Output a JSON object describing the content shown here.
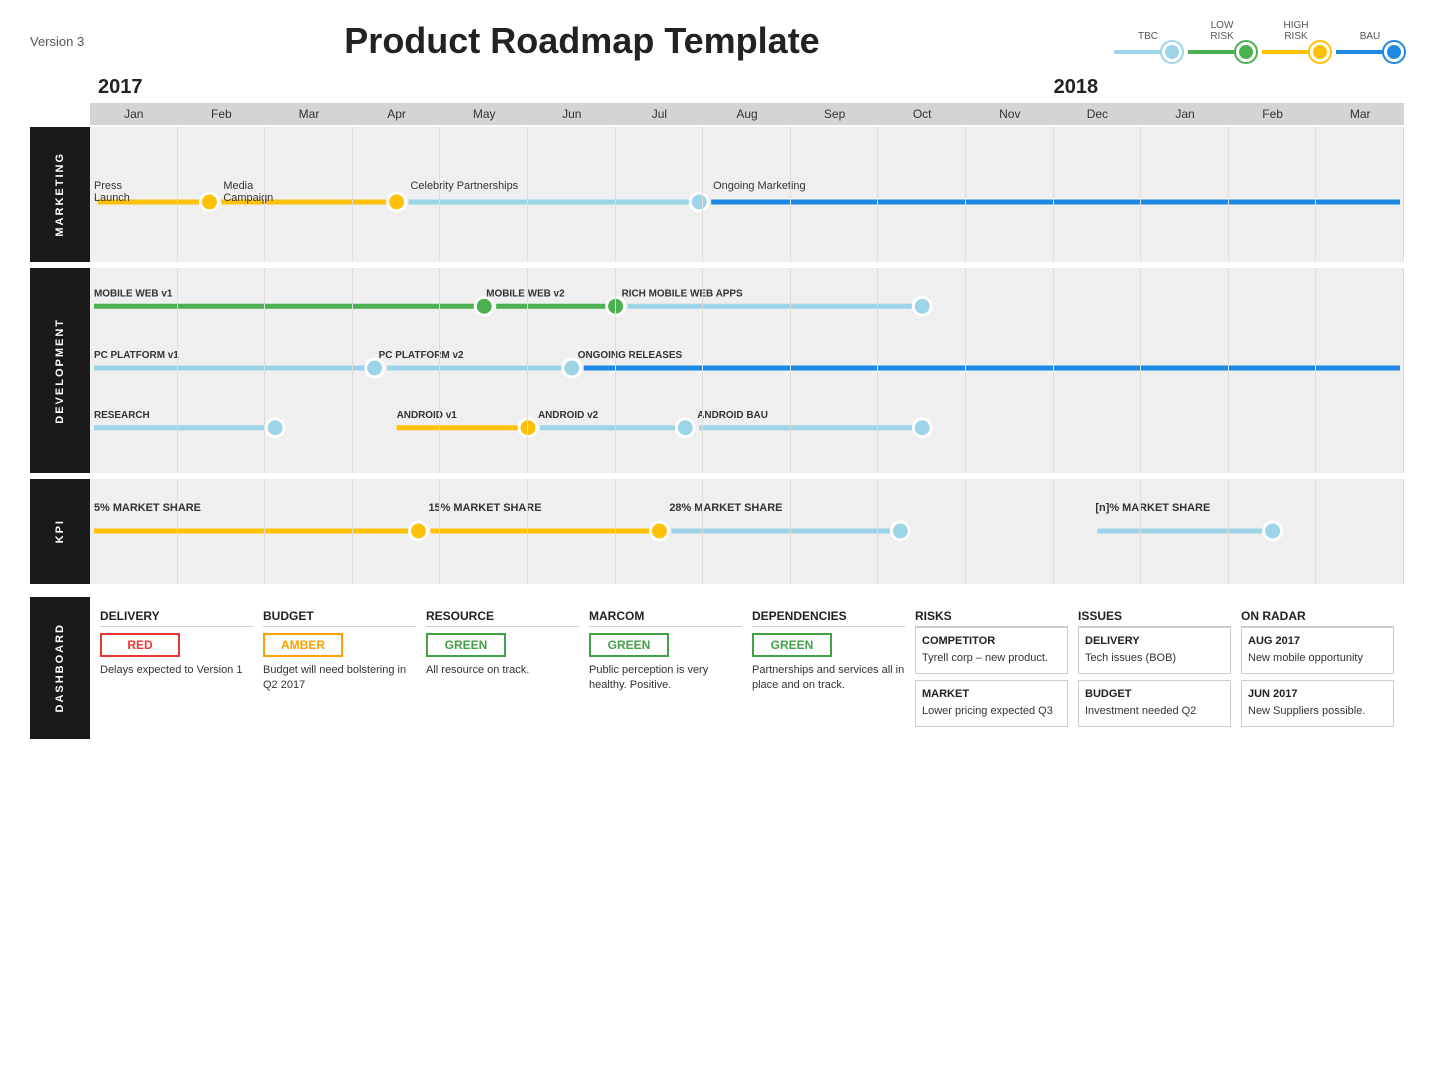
{
  "header": {
    "version": "Version 3",
    "title": "Product Roadmap Template"
  },
  "legend": {
    "items": [
      {
        "id": "tbc",
        "label": "TBC",
        "color": "#9DD4E8"
      },
      {
        "id": "low",
        "label_top": "LOW",
        "label_bottom": "RISK",
        "color": "#4CAF50"
      },
      {
        "id": "high",
        "label_top": "HIGH",
        "label_bottom": "RISK",
        "color": "#FFC107"
      },
      {
        "id": "bau",
        "label": "BAU",
        "color": "#1E88E5"
      }
    ]
  },
  "timeline": {
    "years": [
      {
        "label": "2017",
        "col_start": 1,
        "col_span": 11
      },
      {
        "label": "2018",
        "col_start": 12,
        "col_span": 4
      }
    ],
    "months": [
      "Jan",
      "Feb",
      "Mar",
      "Apr",
      "May",
      "Jun",
      "Jul",
      "Aug",
      "Sep",
      "Oct",
      "Nov",
      "Dec",
      "Jan",
      "Feb",
      "Mar"
    ]
  },
  "sections": {
    "marketing": {
      "label": "MARKETING",
      "rows": [
        {
          "bars": [
            {
              "label": "Press Launch",
              "bar_start_pct": 0,
              "bar_end_pct": 13,
              "color": "#FFC107",
              "ms_end": true,
              "ms_color": "#FFC107"
            },
            {
              "label": "Media Campaign",
              "bar_start_pct": 10,
              "bar_end_pct": 24,
              "color": "#FFC107",
              "ms_end": true,
              "ms_color": "#FFC107"
            },
            {
              "label": "Celebrity Partnerships",
              "bar_start_pct": 24,
              "bar_end_pct": 47,
              "color": "#9DD4E8",
              "ms_end": true,
              "ms_color": "#9DD4E8"
            },
            {
              "label": "Ongoing Marketing",
              "bar_start_pct": 47,
              "bar_end_pct": 100,
              "color": "#1E88E5",
              "ms_end": false,
              "ms_color": "#1E88E5"
            }
          ]
        }
      ]
    },
    "development": {
      "label": "DEVELOPMENT",
      "rows": [
        {
          "label": "MOBILE WEB v1",
          "bars": [
            {
              "bar_start_pct": 0,
              "bar_end_pct": 31,
              "color": "#4CAF50",
              "ms_end": true,
              "ms_color": "#4CAF50"
            }
          ],
          "labels_after": [
            {
              "text": "MOBILE WEB v2",
              "at_pct": 31
            },
            {
              "text": "RICH MOBILE WEB APPS",
              "at_pct": 47
            }
          ],
          "bars2": [
            {
              "bar_start_pct": 31,
              "bar_end_pct": 40,
              "color": "#4CAF50",
              "ms_end": true,
              "ms_color": "#4CAF50"
            },
            {
              "bar_start_pct": 40,
              "bar_end_pct": 65,
              "color": "#9DD4E8",
              "ms_end": true,
              "ms_color": "#9DD4E8"
            }
          ]
        },
        {
          "label": "PC PLATFORM v1",
          "bars": [
            {
              "bar_start_pct": 0,
              "bar_end_pct": 22,
              "color": "#9DD4E8",
              "ms_end": true,
              "ms_color": "#9DD4E8"
            }
          ],
          "labels_after": [
            {
              "text": "PC PLATFORM v2",
              "at_pct": 22
            },
            {
              "text": "ONGOING RELEASES",
              "at_pct": 38
            }
          ],
          "bars2": [
            {
              "bar_start_pct": 22,
              "bar_end_pct": 38,
              "color": "#9DD4E8",
              "ms_end": true,
              "ms_color": "#9DD4E8"
            },
            {
              "bar_start_pct": 38,
              "bar_end_pct": 100,
              "color": "#1E88E5",
              "ms_end": false
            }
          ]
        },
        {
          "label": "RESEARCH",
          "bars": [
            {
              "bar_start_pct": 0,
              "bar_end_pct": 15,
              "color": "#9DD4E8",
              "ms_end": true,
              "ms_color": "#9DD4E8"
            }
          ],
          "labels_after": [
            {
              "text": "ANDROID v1",
              "at_pct": 25
            },
            {
              "text": "ANDROID v2",
              "at_pct": 38
            },
            {
              "text": "ANDROID BAU",
              "at_pct": 53
            }
          ],
          "bars2": [
            {
              "bar_start_pct": 25,
              "bar_end_pct": 35,
              "color": "#FFC107",
              "ms_end": true,
              "ms_color": "#FFC107"
            },
            {
              "bar_start_pct": 35,
              "bar_end_pct": 46,
              "color": "#9DD4E8",
              "ms_end": true,
              "ms_color": "#9DD4E8"
            },
            {
              "bar_start_pct": 46,
              "bar_end_pct": 68,
              "color": "#9DD4E8",
              "ms_end": true,
              "ms_color": "#9DD4E8"
            }
          ]
        }
      ]
    },
    "kpi": {
      "label": "KPI",
      "items": [
        {
          "label": "5% MARKET SHARE",
          "bar_start_pct": 0,
          "bar_end_pct": 27,
          "color": "#FFC107",
          "ms_color": "#FFC107"
        },
        {
          "label": "15% MARKET SHARE",
          "bar_start_pct": 27,
          "bar_end_pct": 47,
          "color": "#FFC107",
          "ms_color": "#FFC107"
        },
        {
          "label": "28% MARKET SHARE",
          "bar_start_pct": 47,
          "bar_end_pct": 65,
          "color": "#9DD4E8",
          "ms_color": "#9DD4E8"
        },
        {
          "label": "[n]% MARKET SHARE",
          "bar_start_pct": 80,
          "bar_end_pct": 92,
          "color": "#9DD4E8",
          "ms_color": "#9DD4E8"
        }
      ]
    }
  },
  "dashboard": {
    "label": "DASHBOARD",
    "columns": [
      {
        "title": "DELIVERY",
        "badge": "RED",
        "badge_type": "red",
        "text": "Delays expected to Version 1"
      },
      {
        "title": "BUDGET",
        "badge": "AMBER",
        "badge_type": "amber",
        "text": "Budget will need bolstering in Q2 2017"
      },
      {
        "title": "RESOURCE",
        "badge": "GREEN",
        "badge_type": "green",
        "text": "All resource on track."
      },
      {
        "title": "MARCOM",
        "badge": "GREEN",
        "badge_type": "green",
        "text": "Public perception is very healthy. Positive."
      },
      {
        "title": "DEPENDENCIES",
        "badge": "GREEN",
        "badge_type": "green",
        "text": "Partnerships and services all in place and on track."
      },
      {
        "title": "RISKS",
        "items": [
          {
            "subtitle": "COMPETITOR",
            "text": "Tyrell corp – new product."
          },
          {
            "subtitle": "MARKET",
            "text": "Lower pricing expected Q3"
          }
        ]
      },
      {
        "title": "ISSUES",
        "items": [
          {
            "subtitle": "DELIVERY",
            "text": "Tech issues (BOB)"
          },
          {
            "subtitle": "BUDGET",
            "text": "Investment needed Q2"
          }
        ]
      },
      {
        "title": "ON RADAR",
        "items": [
          {
            "subtitle": "AUG 2017",
            "text": "New mobile opportunity"
          },
          {
            "subtitle": "JUN 2017",
            "text": "New Suppliers possible."
          }
        ]
      }
    ]
  }
}
